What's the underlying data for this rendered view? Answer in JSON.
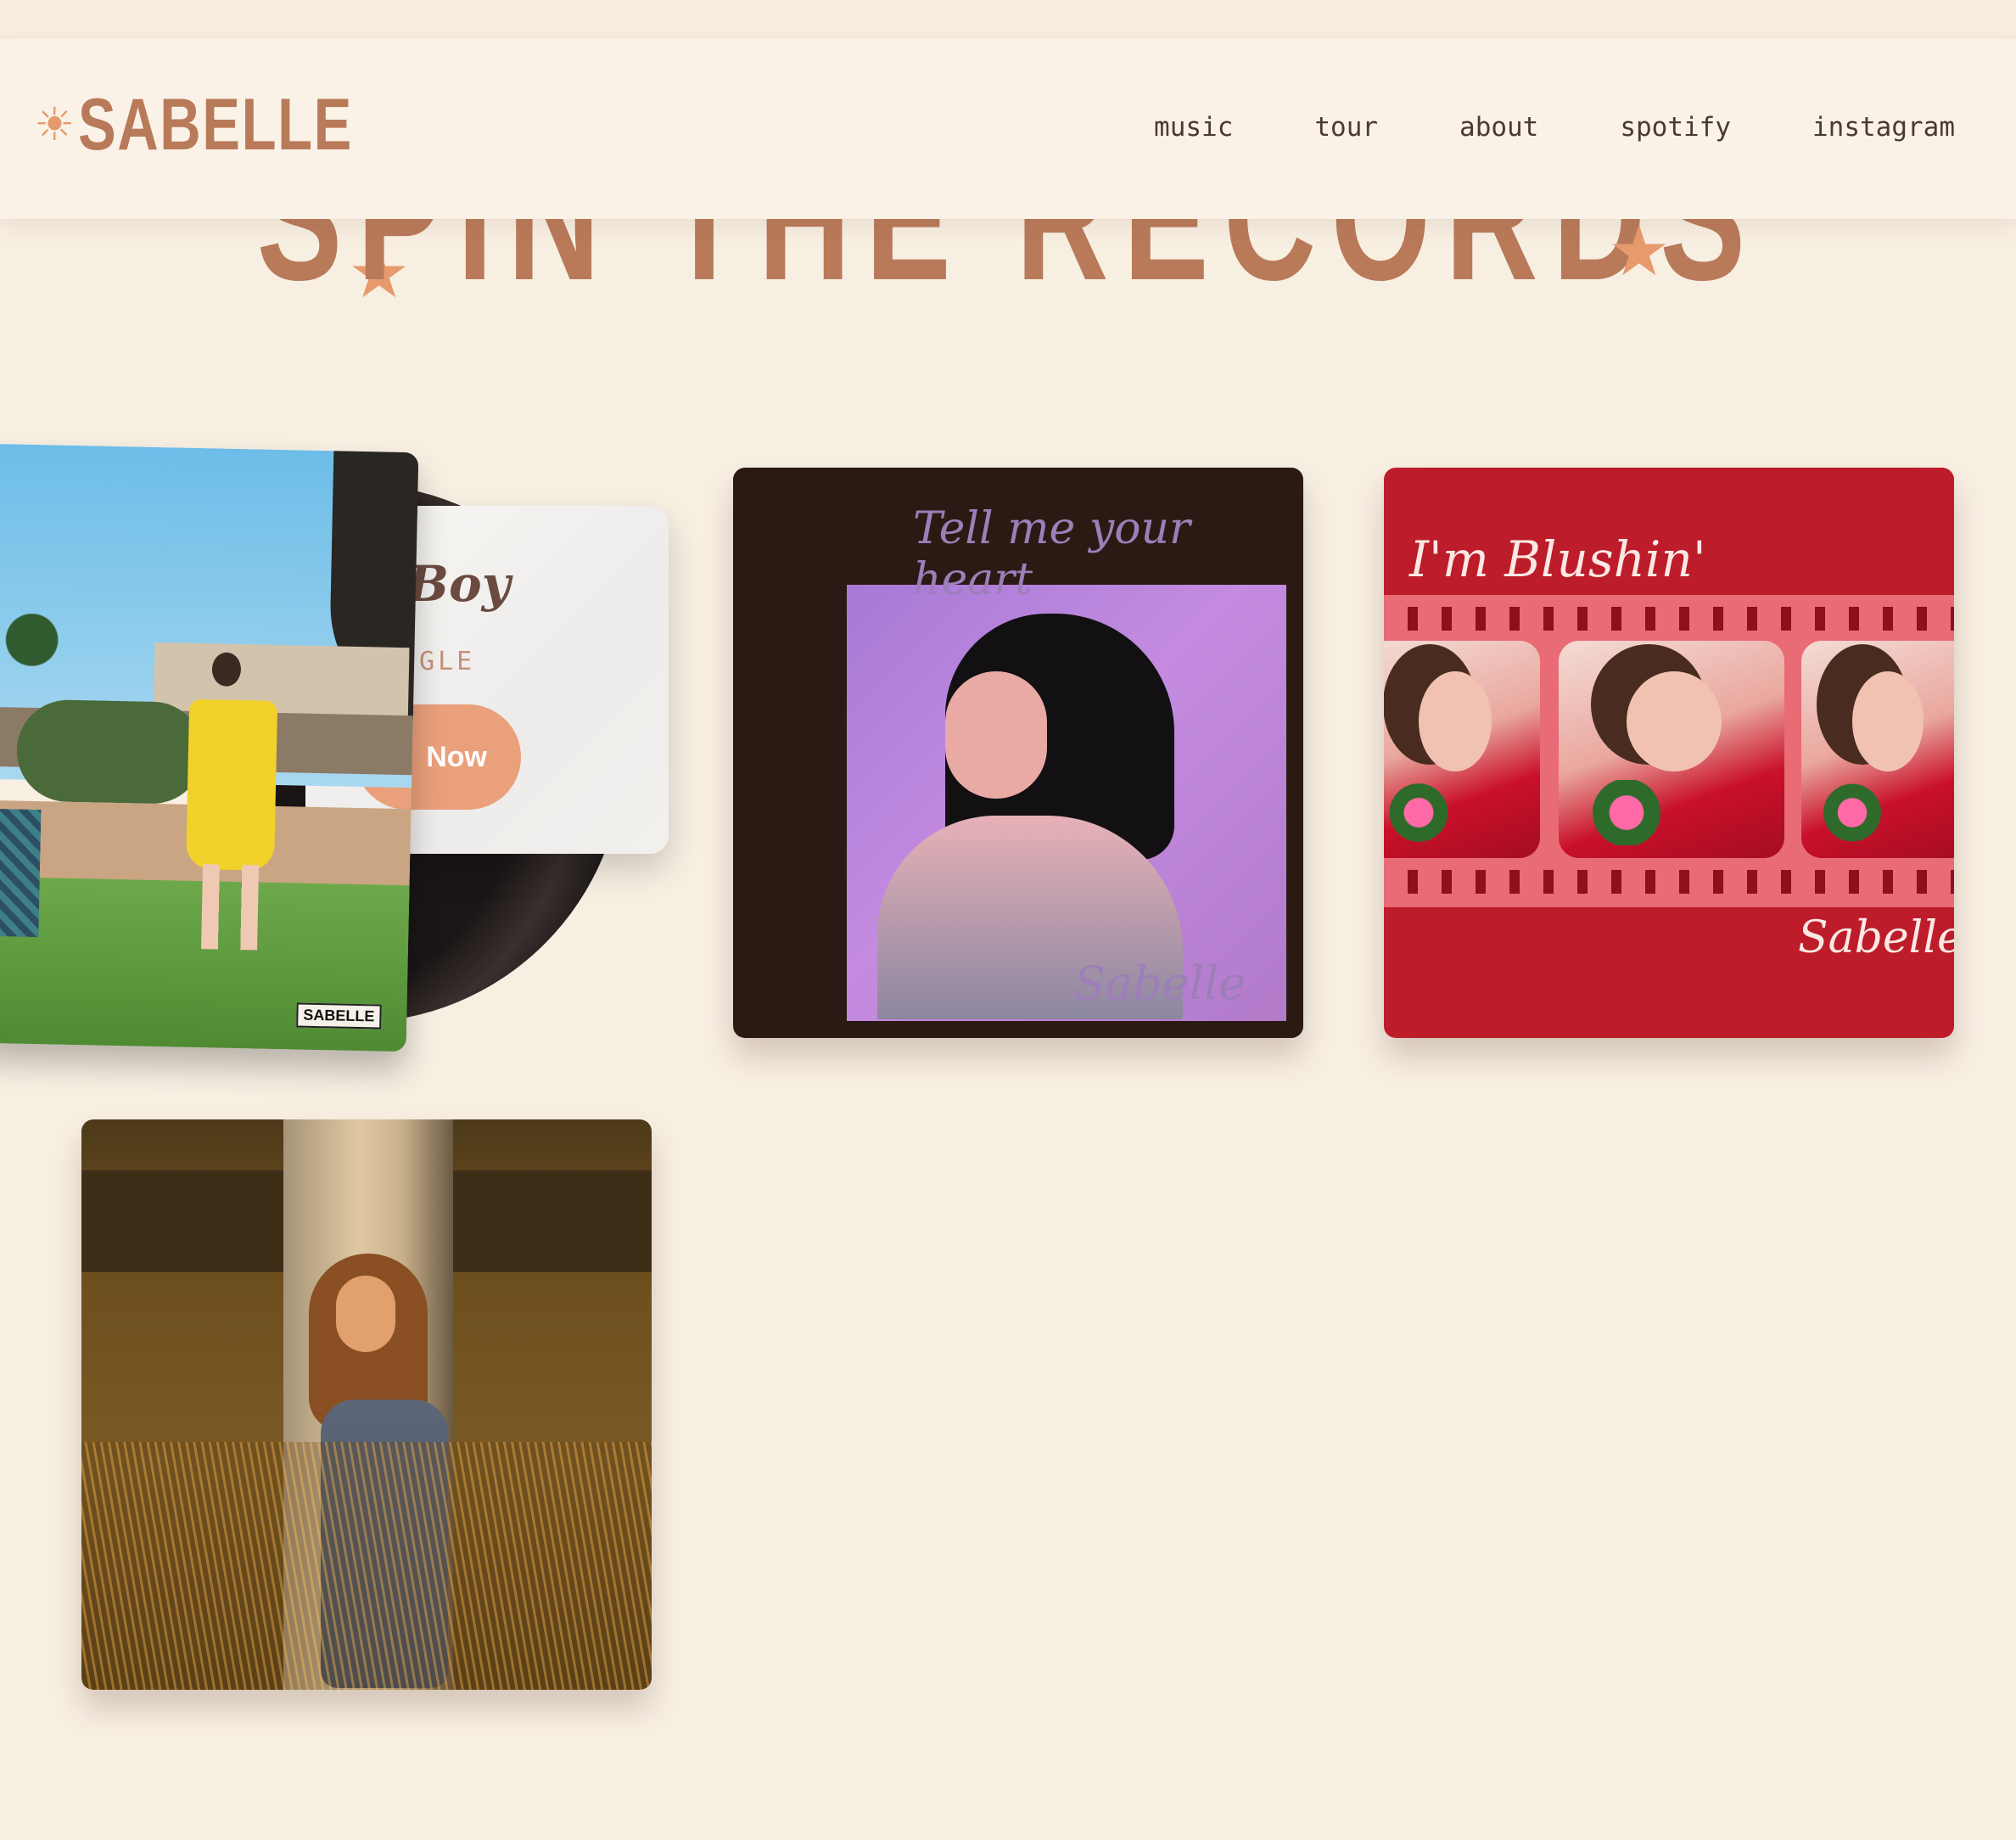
{
  "header": {
    "logo_symbol": "☀",
    "logo_text": "SABELLE",
    "nav": [
      "music",
      "tour",
      "about",
      "spotify",
      "instagram"
    ]
  },
  "section": {
    "title": "SPIN THE RECORDS",
    "star": "★"
  },
  "featured": {
    "title_partial": "Boy",
    "type_partial": "NGLE",
    "button_partial": "Now",
    "cover_badge": "SABELLE"
  },
  "albums": [
    {
      "script_title": "Tell me your heart",
      "signature": "Sabelle"
    },
    {
      "script_title": "I'm Blushin'",
      "signature": "Sabelle"
    },
    {
      "script_title": "",
      "signature": ""
    }
  ],
  "colors": {
    "background": "#f8efe3",
    "header_bg": "#faf2e7",
    "brand": "#b97a5a",
    "accent": "#e79a6c",
    "nav_text": "#4a3a33"
  }
}
